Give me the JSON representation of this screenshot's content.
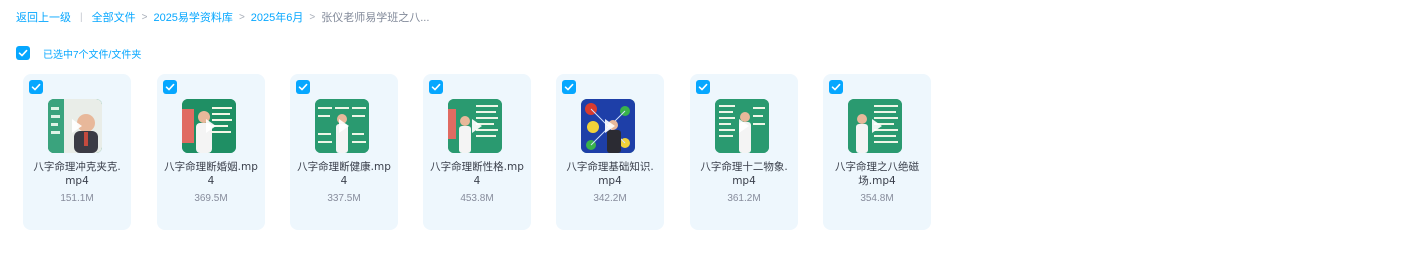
{
  "breadcrumb": {
    "back": "返回上一级",
    "sep1": "|",
    "items": [
      "全部文件",
      "2025易学资料库",
      "2025年6月"
    ],
    "arrow": ">",
    "current": "张仪老师易学班之八..."
  },
  "selection": {
    "label": "已选中7个文件/文件夹",
    "checked": true
  },
  "files": [
    {
      "name": "八字命理冲克夹克.mp4",
      "size": "151.1M",
      "thumb": "green-lecture",
      "checked": true
    },
    {
      "name": "八字命理断婚姻.mp4",
      "size": "369.5M",
      "thumb": "red-board-lecture",
      "checked": true
    },
    {
      "name": "八字命理断健康.mp4",
      "size": "337.5M",
      "thumb": "green-board-video",
      "checked": true
    },
    {
      "name": "八字命理断性格.mp4",
      "size": "453.8M",
      "thumb": "green-board-video",
      "checked": true
    },
    {
      "name": "八字命理基础知识.mp4",
      "size": "342.2M",
      "thumb": "blue-diagram-lecture",
      "checked": true
    },
    {
      "name": "八字命理十二物象.mp4",
      "size": "361.2M",
      "thumb": "green-board-lecture",
      "checked": true
    },
    {
      "name": "八字命理之八绝磁场.mp4",
      "size": "354.8M",
      "thumb": "green-board-lecture",
      "checked": true
    }
  ],
  "icons": {
    "checkbox": "checkmark-icon",
    "play": "play-icon"
  },
  "colors": {
    "accent": "#06a7ff",
    "card_bg": "#eef7fd",
    "text": "#3a3f4b",
    "muted": "#878c9c"
  }
}
